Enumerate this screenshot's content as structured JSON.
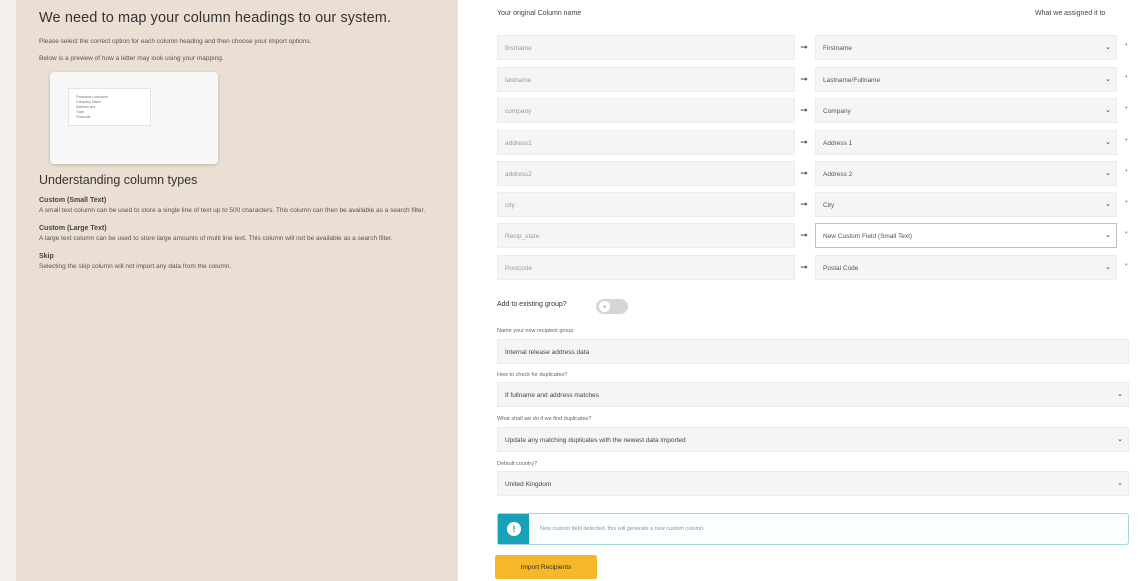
{
  "left": {
    "heading": "We need to map your column headings to our system.",
    "instructions": [
      "Please select the correct option for each column heading and then choose your import options.",
      "Below is a preview of how a letter may look using your mapping."
    ],
    "preview_lines": [
      "Firstname Lastname",
      "Company Name",
      "Address line",
      "Town",
      "Postcode"
    ],
    "types_heading": "Understanding column types",
    "types": [
      {
        "title": "Custom (Small Text)",
        "desc": "A small text column can be used to store a single line of text up to 500 characters. This column can then be available as a search filter."
      },
      {
        "title": "Custom (Large Text)",
        "desc": "A large text column can be used to store large amounts of multi line text. This column will not be available as a search filter."
      },
      {
        "title": "Skip",
        "desc": "Selecting the skip column will not import any data from the column."
      }
    ]
  },
  "mapping": {
    "orig_header": "Your original Column name",
    "assigned_header": "What we assigned it to",
    "rows": [
      {
        "original": "firstname",
        "assigned": "Firstname"
      },
      {
        "original": "lastname",
        "assigned": "Lastname/Fullname"
      },
      {
        "original": "company",
        "assigned": "Company"
      },
      {
        "original": "address1",
        "assigned": "Address 1"
      },
      {
        "original": "address2",
        "assigned": "Address 2"
      },
      {
        "original": "city",
        "assigned": "City"
      },
      {
        "original": "Recip_state",
        "assigned": "New Custom Field (Small Text)"
      },
      {
        "original": "Postcode",
        "assigned": "Postal Code"
      }
    ],
    "arrow": "➞",
    "chevron": "⌄",
    "required_mark": "*"
  },
  "options": {
    "add_group_label": "Add to existing group?",
    "toggle_text": "✕",
    "group_name_label": "Name your new recipient group",
    "group_name_value": "Internal release address data",
    "duplicates_label": "How to check for duplicates?",
    "duplicates_value": "If fullname and address matches",
    "duplicate_action_label": "What shall we do if we find duplicates?",
    "duplicate_action_value": "Update any matching duplicates with the newest data imported",
    "country_label": "Default country?",
    "country_value": "United Kingdom"
  },
  "notice": {
    "icon": "!",
    "text": "New custom field detected, this will generate a new custom column."
  },
  "import_button": "Import Recipients"
}
